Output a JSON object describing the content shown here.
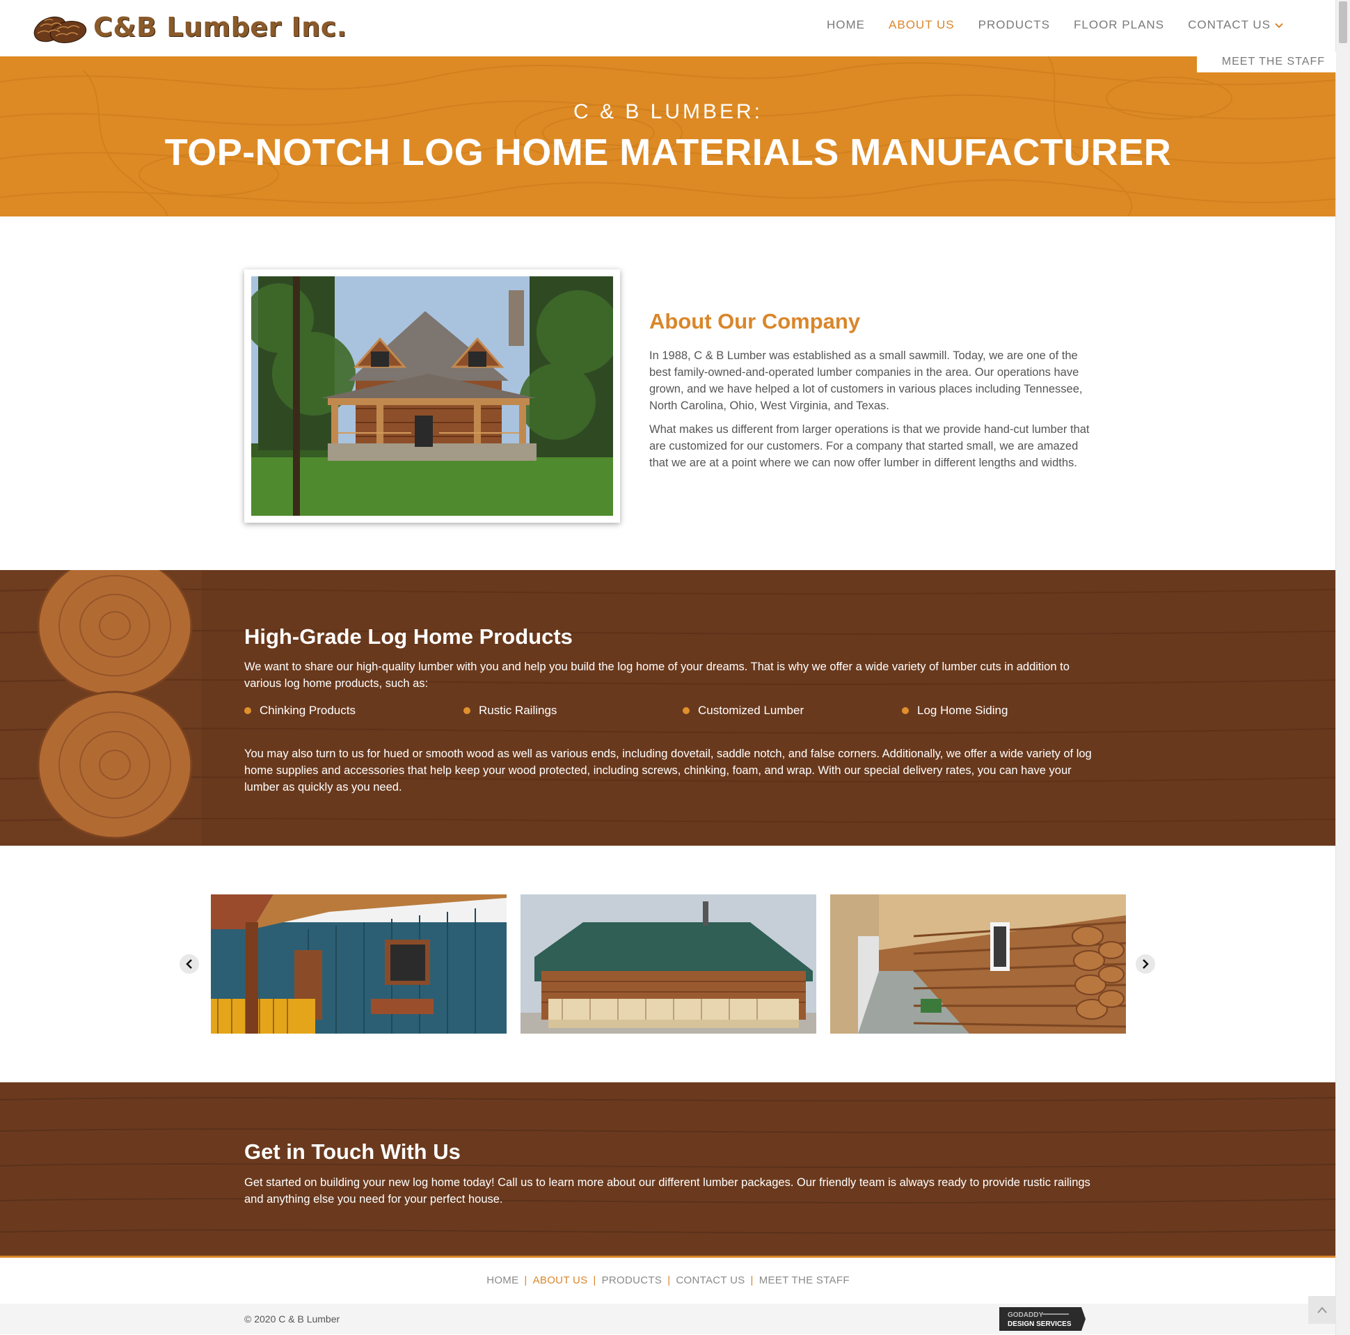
{
  "header": {
    "logo_text": "C&B Lumber Inc.",
    "nav": [
      {
        "label": "HOME",
        "active": false
      },
      {
        "label": "ABOUT US",
        "active": true
      },
      {
        "label": "PRODUCTS",
        "active": false
      },
      {
        "label": "FLOOR PLANS",
        "active": false
      },
      {
        "label": "CONTACT US",
        "active": false
      }
    ],
    "submenu_item": "MEET THE STAFF"
  },
  "hero": {
    "subtitle": "C & B LUMBER:",
    "title": "TOP-NOTCH LOG HOME MATERIALS MANUFACTURER"
  },
  "about": {
    "heading": "About Our Company",
    "paragraph1": "In 1988, C & B Lumber was established as a small sawmill. Today, we are one of the best family-owned-and-operated lumber companies in the area. Our operations have grown, and we have helped a lot of customers in various places including Tennessee, North Carolina, Ohio, West Virginia, and Texas.",
    "paragraph2": "What makes us different from larger operations is that we provide hand-cut lumber that are customized for our customers. For a company that started small, we are amazed that we are at a point where we can now offer lumber in different lengths and widths."
  },
  "products": {
    "heading": "High-Grade Log Home Products",
    "intro": "We want to share our high-quality lumber with you and help you build the log home of your dreams. That is why we offer a wide variety of lumber cuts in addition to various log home products, such as:",
    "items": [
      "Chinking Products",
      "Rustic Railings",
      "Customized Lumber",
      "Log Home Siding"
    ],
    "more": "You may also turn to us for hued or smooth wood as well as various ends, including dovetail, saddle notch, and false corners. Additionally, we offer a wide variety of log home supplies and accessories that help keep your wood protected, including screws, chinking, foam, and wrap. With our special delivery rates, you can have your lumber as quickly as you need."
  },
  "contact": {
    "heading": "Get in Touch With Us",
    "text": "Get started on building your new log home today! Call us to learn more about our different lumber packages. Our friendly team is always ready to provide rustic railings and anything else you need for your perfect house."
  },
  "footer": {
    "links": [
      {
        "label": "HOME",
        "active": false
      },
      {
        "label": "ABOUT US",
        "active": true
      },
      {
        "label": "PRODUCTS",
        "active": false
      },
      {
        "label": "CONTACT US",
        "active": false
      },
      {
        "label": "MEET THE STAFF",
        "active": false
      }
    ],
    "copyright": "© 2020 C & B Lumber",
    "badge_line1": "GODADDY",
    "badge_line2": "DESIGN SERVICES"
  },
  "icons": {
    "dropdown": "chevron-down-icon",
    "prev": "chevron-left-icon",
    "next": "chevron-right-icon",
    "to_top": "arrow-up-icon",
    "bullet": "dot-icon"
  },
  "colors": {
    "accent": "#d9862a",
    "hero_bg": "#dd8a25",
    "wood": "#6b3a1e"
  }
}
